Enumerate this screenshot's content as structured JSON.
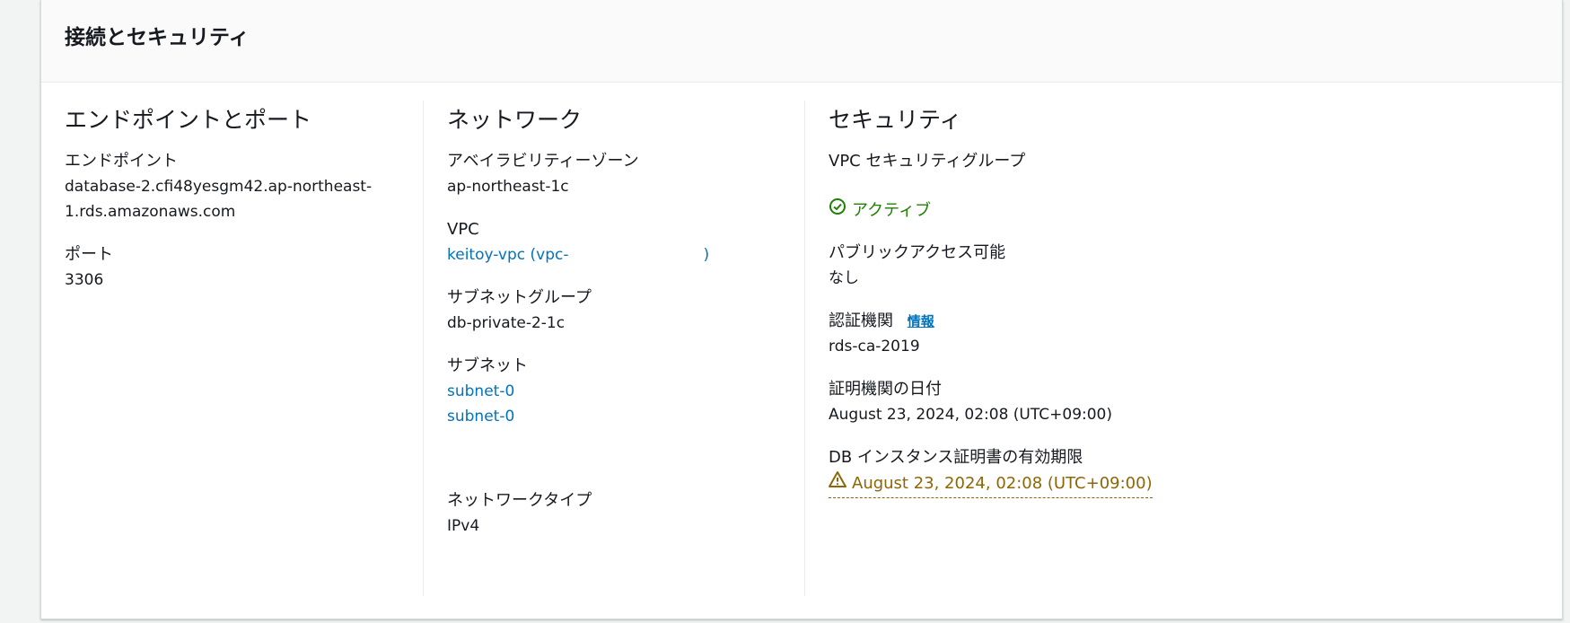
{
  "panel": {
    "title": "接続とセキュリティ"
  },
  "endpoint_section": {
    "heading": "エンドポイントとポート",
    "endpoint_label": "エンドポイント",
    "endpoint_line1": "database-2.cfi48yesgm42.ap-northeast-",
    "endpoint_line2": "1.rds.amazonaws.com",
    "port_label": "ポート",
    "port_value": "3306"
  },
  "network_section": {
    "heading": "ネットワーク",
    "az_label": "アベイラビリティーゾーン",
    "az_value": "ap-northeast-1c",
    "vpc_label": "VPC",
    "vpc_value": "keitoy-vpc (vpc-",
    "vpc_suffix": ")",
    "subnet_group_label": "サブネットグループ",
    "subnet_group_value": "db-private-2-1c",
    "subnet_label": "サブネット",
    "subnet_1": "subnet-0",
    "subnet_2": "subnet-0",
    "network_type_label": "ネットワークタイプ",
    "network_type_value": "IPv4"
  },
  "security_section": {
    "heading": "セキュリティ",
    "sg_label": "VPC セキュリティグループ",
    "sg_status": "アクティブ",
    "public_label": "パブリックアクセス可能",
    "public_value": "なし",
    "ca_label": "認証機関",
    "ca_info": "情報",
    "ca_value": "rds-ca-2019",
    "ca_date_label": "証明機関の日付",
    "ca_date_value": "August 23, 2024, 02:08 (UTC+09:00)",
    "cert_expiry_label": "DB インスタンス証明書の有効期限",
    "cert_expiry_value": "August 23, 2024, 02:08 (UTC+09:00)"
  },
  "colors": {
    "link": "#0073bb",
    "success": "#1d8102",
    "warning": "#8d6605"
  },
  "icons": {
    "status_ok": "check-circle-icon",
    "warning": "warning-icon"
  }
}
